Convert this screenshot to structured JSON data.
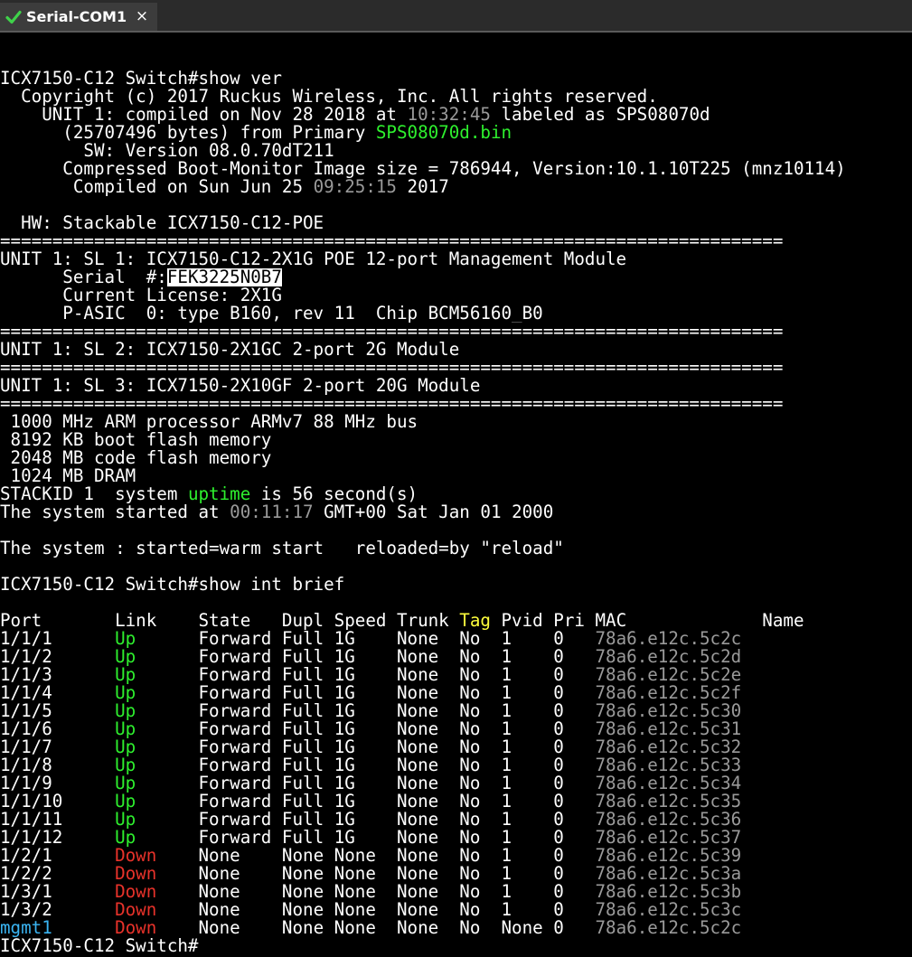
{
  "tab": {
    "title": "Serial-COM1",
    "status_icon": "check-icon",
    "close_glyph": "×"
  },
  "lines": [
    [],
    [
      {
        "t": "ICX7150-C12 Switch#show ver"
      }
    ],
    [
      {
        "t": "  Copyright (c) 2017 Ruckus Wireless, Inc. All rights reserved."
      }
    ],
    [
      {
        "t": "    UNIT 1: compiled on Nov 28 2018 at "
      },
      {
        "t": "10:32:45",
        "c": "gray"
      },
      {
        "t": " labeled as SPS08070d"
      }
    ],
    [
      {
        "t": "      (25707496 bytes) from Primary "
      },
      {
        "t": "SPS08070d.bin",
        "c": "green"
      }
    ],
    [
      {
        "t": "        SW: Version 08.0.70dT211"
      }
    ],
    [
      {
        "t": "      Compressed Boot-Monitor Image size = 786944, Version:10.1.10T225 (mnz10114)"
      }
    ],
    [
      {
        "t": "       Compiled on Sun Jun 25 "
      },
      {
        "t": "09:25:15",
        "c": "gray"
      },
      {
        "t": " 2017"
      }
    ],
    [],
    [
      {
        "t": "  HW: Stackable ICX7150-C12-POE"
      }
    ],
    [
      {
        "t": "==========================================================================="
      }
    ],
    [
      {
        "t": "UNIT 1: SL 1: ICX7150-C12-2X1G POE 12-port Management Module"
      }
    ],
    [
      {
        "t": "      Serial  #:"
      },
      {
        "t": "FEK3225N0B7",
        "c": "hl"
      }
    ],
    [
      {
        "t": "      Current License: 2X1G"
      }
    ],
    [
      {
        "t": "      P-ASIC  0: type B160, rev 11  Chip BCM56160_B0"
      }
    ],
    [
      {
        "t": "==========================================================================="
      }
    ],
    [
      {
        "t": "UNIT 1: SL 2: ICX7150-2X1GC 2-port 2G Module"
      }
    ],
    [
      {
        "t": "==========================================================================="
      }
    ],
    [
      {
        "t": "UNIT 1: SL 3: ICX7150-2X10GF 2-port 20G Module"
      }
    ],
    [
      {
        "t": "==========================================================================="
      }
    ],
    [
      {
        "t": " 1000 MHz ARM processor ARMv7 88 MHz bus"
      }
    ],
    [
      {
        "t": " 8192 KB boot flash memory"
      }
    ],
    [
      {
        "t": " 2048 MB code flash memory"
      }
    ],
    [
      {
        "t": " 1024 MB DRAM"
      }
    ],
    [
      {
        "t": "STACKID 1  system "
      },
      {
        "t": "uptime",
        "c": "green"
      },
      {
        "t": " is 56 second(s)"
      }
    ],
    [
      {
        "t": "The system started at "
      },
      {
        "t": "00:11:17",
        "c": "gray"
      },
      {
        "t": " GMT+00 Sat Jan 01 2000"
      }
    ],
    [],
    [
      {
        "t": "The system : started=warm start   reloaded=by \"reload\""
      }
    ],
    [],
    [
      {
        "t": "ICX7150-C12 Switch#show int brief"
      }
    ],
    [],
    [
      {
        "t": "Port       Link    State   Dupl Speed Trunk "
      },
      {
        "t": "Tag",
        "c": "yellow"
      },
      {
        "t": " Pvid Pri MAC             Name"
      }
    ],
    [
      {
        "t": "1/1/1      "
      },
      {
        "t": "Up",
        "c": "green"
      },
      {
        "t": "      Forward Full 1G    None  No  1    0   "
      },
      {
        "t": "78a6.e12c.5c2c",
        "c": "gray"
      }
    ],
    [
      {
        "t": "1/1/2      "
      },
      {
        "t": "Up",
        "c": "green"
      },
      {
        "t": "      Forward Full 1G    None  No  1    0   "
      },
      {
        "t": "78a6.e12c.5c2d",
        "c": "gray"
      }
    ],
    [
      {
        "t": "1/1/3      "
      },
      {
        "t": "Up",
        "c": "green"
      },
      {
        "t": "      Forward Full 1G    None  No  1    0   "
      },
      {
        "t": "78a6.e12c.5c2e",
        "c": "gray"
      }
    ],
    [
      {
        "t": "1/1/4      "
      },
      {
        "t": "Up",
        "c": "green"
      },
      {
        "t": "      Forward Full 1G    None  No  1    0   "
      },
      {
        "t": "78a6.e12c.5c2f",
        "c": "gray"
      }
    ],
    [
      {
        "t": "1/1/5      "
      },
      {
        "t": "Up",
        "c": "green"
      },
      {
        "t": "      Forward Full 1G    None  No  1    0   "
      },
      {
        "t": "78a6.e12c.5c30",
        "c": "gray"
      }
    ],
    [
      {
        "t": "1/1/6      "
      },
      {
        "t": "Up",
        "c": "green"
      },
      {
        "t": "      Forward Full 1G    None  No  1    0   "
      },
      {
        "t": "78a6.e12c.5c31",
        "c": "gray"
      }
    ],
    [
      {
        "t": "1/1/7      "
      },
      {
        "t": "Up",
        "c": "green"
      },
      {
        "t": "      Forward Full 1G    None  No  1    0   "
      },
      {
        "t": "78a6.e12c.5c32",
        "c": "gray"
      }
    ],
    [
      {
        "t": "1/1/8      "
      },
      {
        "t": "Up",
        "c": "green"
      },
      {
        "t": "      Forward Full 1G    None  No  1    0   "
      },
      {
        "t": "78a6.e12c.5c33",
        "c": "gray"
      }
    ],
    [
      {
        "t": "1/1/9      "
      },
      {
        "t": "Up",
        "c": "green"
      },
      {
        "t": "      Forward Full 1G    None  No  1    0   "
      },
      {
        "t": "78a6.e12c.5c34",
        "c": "gray"
      }
    ],
    [
      {
        "t": "1/1/10     "
      },
      {
        "t": "Up",
        "c": "green"
      },
      {
        "t": "      Forward Full 1G    None  No  1    0   "
      },
      {
        "t": "78a6.e12c.5c35",
        "c": "gray"
      }
    ],
    [
      {
        "t": "1/1/11     "
      },
      {
        "t": "Up",
        "c": "green"
      },
      {
        "t": "      Forward Full 1G    None  No  1    0   "
      },
      {
        "t": "78a6.e12c.5c36",
        "c": "gray"
      }
    ],
    [
      {
        "t": "1/1/12     "
      },
      {
        "t": "Up",
        "c": "green"
      },
      {
        "t": "      Forward Full 1G    None  No  1    0   "
      },
      {
        "t": "78a6.e12c.5c37",
        "c": "gray"
      }
    ],
    [
      {
        "t": "1/2/1      "
      },
      {
        "t": "Down",
        "c": "red"
      },
      {
        "t": "    None    None None  None  No  1    0   "
      },
      {
        "t": "78a6.e12c.5c39",
        "c": "gray"
      }
    ],
    [
      {
        "t": "1/2/2      "
      },
      {
        "t": "Down",
        "c": "red"
      },
      {
        "t": "    None    None None  None  No  1    0   "
      },
      {
        "t": "78a6.e12c.5c3a",
        "c": "gray"
      }
    ],
    [
      {
        "t": "1/3/1      "
      },
      {
        "t": "Down",
        "c": "red"
      },
      {
        "t": "    None    None None  None  No  1    0   "
      },
      {
        "t": "78a6.e12c.5c3b",
        "c": "gray"
      }
    ],
    [
      {
        "t": "1/3/2      "
      },
      {
        "t": "Down",
        "c": "red"
      },
      {
        "t": "    None    None None  None  No  1    0   "
      },
      {
        "t": "78a6.e12c.5c3c",
        "c": "gray"
      }
    ],
    [
      {
        "t": "mgmt1",
        "c": "blue"
      },
      {
        "t": "      "
      },
      {
        "t": "Down",
        "c": "red"
      },
      {
        "t": "    None    None None  None  No  None 0   "
      },
      {
        "t": "78a6.e12c.5c2c",
        "c": "gray"
      }
    ],
    [
      {
        "t": "ICX7150-C12 Switch#"
      }
    ]
  ],
  "colors": {
    "background": "#000000",
    "text": "#ffffff",
    "gray": "#9a9a9a",
    "green": "#2ef02e",
    "yellow": "#ffff3c",
    "red": "#e8322a",
    "blue": "#3ab4f2",
    "tab_bg": "#3c3c3c",
    "tabbar_bg": "#2b2b2b"
  }
}
